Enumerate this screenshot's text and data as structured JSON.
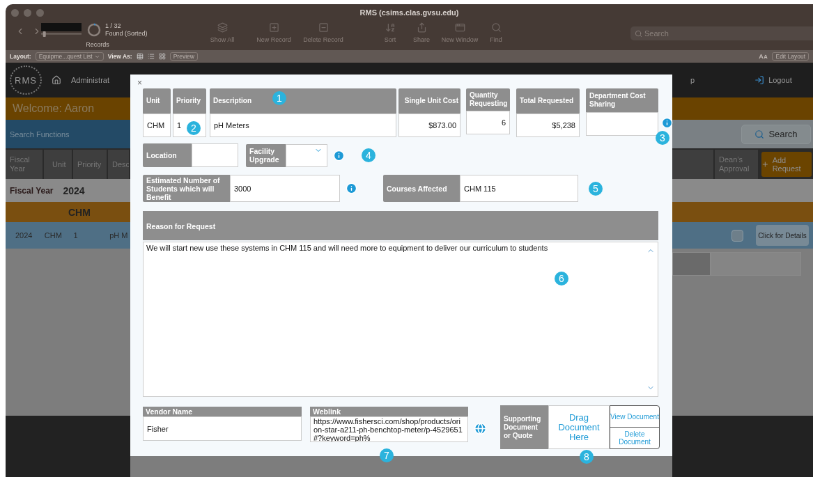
{
  "window": {
    "title": "RMS (csims.clas.gvsu.edu)"
  },
  "toolbar": {
    "slider": {
      "level": 0.05
    },
    "position": "1 / 32",
    "status": "Found (Sorted)",
    "records_label": "Records",
    "buttons": [
      {
        "kind": "showall",
        "label": "Show All"
      },
      {
        "kind": "new",
        "label": "New Record"
      },
      {
        "kind": "delete",
        "label": "Delete Record"
      },
      {
        "kind": "sort",
        "label": "Sort"
      },
      {
        "kind": "share",
        "label": "Share"
      },
      {
        "kind": "window",
        "label": "New Window"
      },
      {
        "kind": "find",
        "label": "Find"
      }
    ],
    "search": {
      "placeholder": "Search"
    }
  },
  "layout_bar": {
    "layout_label": "Layout:",
    "layout_value": "Equipme...quest List",
    "view_as": "View As:",
    "preview": "Preview",
    "edit_layout": "Edit Layout"
  },
  "app": {
    "logo": "RMS",
    "nav_left": "Administrat",
    "nav_right": "p",
    "logout": "Logout",
    "welcome": "Welcome: Aaron",
    "search_functions": "Search Functions",
    "search_button": "Search",
    "columns_left": [
      "Fiscal Year",
      "Unit",
      "Priority",
      "Desc"
    ],
    "columns_right": [
      "Dean’s Approval"
    ],
    "add_request": "Add Request",
    "fiscal_year_label": "Fiscal Year",
    "fiscal_year": "2024",
    "group": "CHM",
    "row": {
      "cells": [
        "2024",
        "CHM",
        "1",
        "pH M"
      ],
      "checked": false,
      "details_button": "Click for Details"
    }
  },
  "modal": {
    "close": "×",
    "top_fields": [
      {
        "kind": "text",
        "label": "Unit",
        "value": "CHM"
      },
      {
        "kind": "text",
        "label": "Priority",
        "value": "1"
      },
      {
        "kind": "text",
        "label": "Description",
        "value": "pH Meters"
      },
      {
        "kind": "number",
        "label": "Single Unit Cost",
        "value": "$873.00"
      },
      {
        "kind": "number",
        "label": "Quantity Requesting",
        "value": "6"
      },
      {
        "kind": "number",
        "label": "Total Requested",
        "value": "$5,238"
      },
      {
        "kind": "text",
        "label": "Department Cost Sharing"
      }
    ],
    "location": {
      "label": "Location"
    },
    "facility": {
      "label": "Facility Upgrade"
    },
    "students": {
      "label": "Estimated Number of Students which will Benefit",
      "value": "3000"
    },
    "courses": {
      "label": "Courses Affected",
      "value": "CHM 115"
    },
    "reason": {
      "label": "Reason for Request",
      "value": "We will start new use these systems in CHM 115 and will need more to equipment to deliver our curriculum to students"
    },
    "vendor": {
      "label": "Vendor Name",
      "value": "Fisher"
    },
    "weblink": {
      "label": "Weblink",
      "value": "https://www.fishersci.com/shop/products/orion-star-a211-ph-benchtop-meter/p-4529651#?keyword=ph%"
    },
    "document": {
      "label": "Supporting Document or Quote",
      "drop": "Drag Document Here",
      "view": "View Document",
      "delete": "Delete Document"
    },
    "markers": [
      "1",
      "2",
      "3",
      "4",
      "5",
      "6",
      "7",
      "8"
    ]
  }
}
